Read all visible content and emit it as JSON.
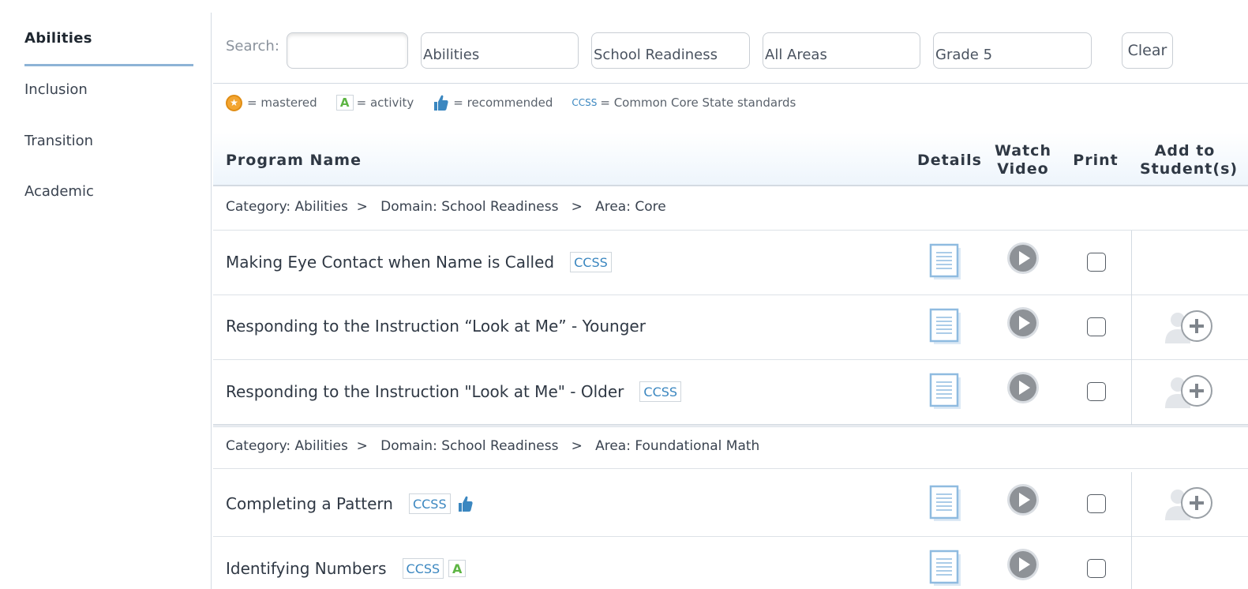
{
  "sidebar": {
    "items": [
      {
        "label": "Abilities",
        "active": true
      },
      {
        "label": "Inclusion"
      },
      {
        "label": "Transition"
      },
      {
        "label": "Academic"
      }
    ]
  },
  "search": {
    "label": "Search:",
    "query": "",
    "filters": [
      "Abilities",
      "School Readiness",
      "All Areas",
      "Grade 5"
    ],
    "clear_label": "Clear"
  },
  "legend": {
    "mastered": "= mastered",
    "activity_badge": "A",
    "activity": "= activity",
    "recommended": "= recommended",
    "ccss_badge": "CCSS",
    "ccss": "= Common Core State standards"
  },
  "table": {
    "headers": {
      "program_name": "Program Name",
      "details": "Details",
      "watch_video_1": "Watch",
      "watch_video_2": "Video",
      "print": "Print",
      "add_1": "Add to",
      "add_2": "Student(s)"
    },
    "groups": [
      {
        "category": "Category: Abilities  >   Domain: School Readiness   >   Area: Core",
        "rows": [
          {
            "name": "Making Eye Contact when Name is Called",
            "ccss": "CCSS",
            "activity": "",
            "recommended": false,
            "add": false
          },
          {
            "name": "Responding to the Instruction “Look at Me” - Younger",
            "ccss": "",
            "activity": "",
            "recommended": false,
            "add": true
          },
          {
            "name": "Responding to the Instruction \"Look at Me\" - Older",
            "ccss": "CCSS",
            "activity": "",
            "recommended": false,
            "add": true
          }
        ]
      },
      {
        "category": "Category: Abilities  >   Domain: School Readiness   >   Area: Foundational Math",
        "rows": [
          {
            "name": "Completing a Pattern",
            "ccss": "CCSS",
            "activity": "",
            "recommended": true,
            "add": true
          },
          {
            "name": "Identifying Numbers",
            "ccss": "CCSS",
            "activity": "A",
            "recommended": false,
            "add": false
          }
        ]
      }
    ]
  },
  "colors": {
    "accent": "#8db3d6",
    "ccss_text": "#3b87c0",
    "activity_green": "#5db544",
    "thumb_blue": "#3b87c0",
    "star_orange": "#f3a531"
  },
  "icons": {
    "details": "document-icon",
    "video": "play-circle-icon",
    "add": "add-student-icon",
    "recommended": "thumbs-up-icon",
    "mastered": "star-icon"
  }
}
